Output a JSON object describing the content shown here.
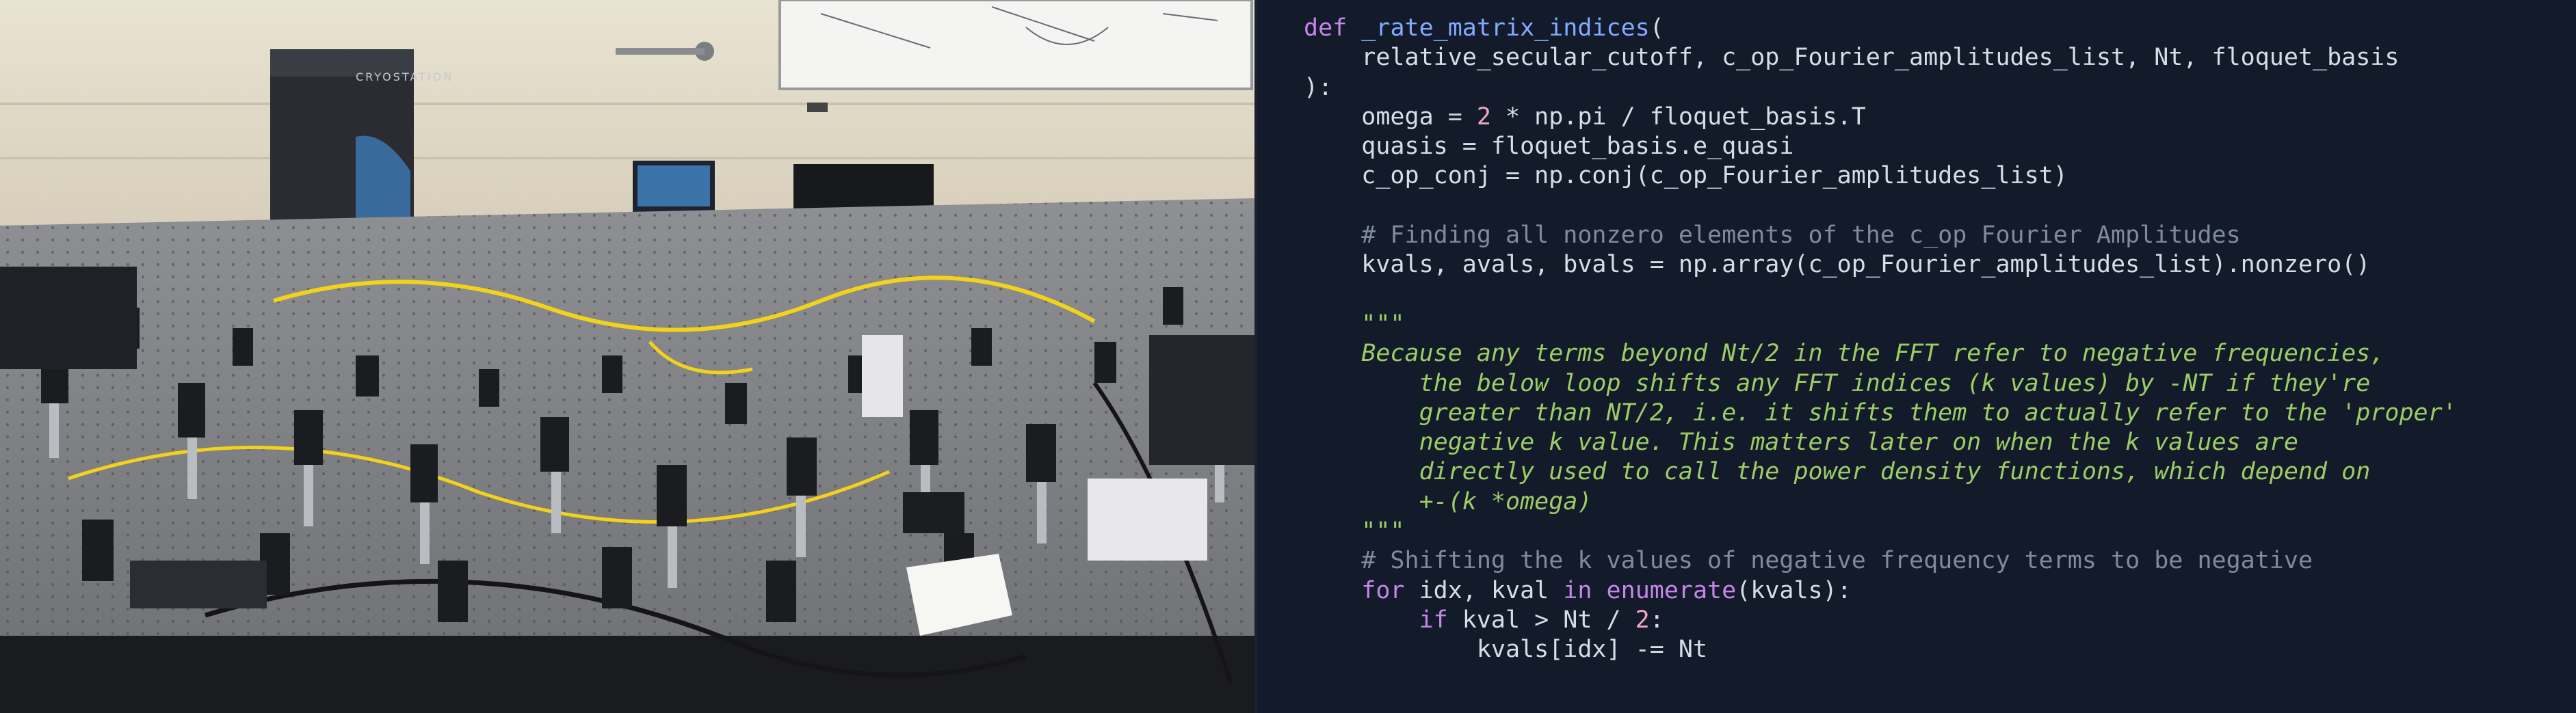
{
  "photo": {
    "description_icon": "lab-photo",
    "cryostation_label": "CRYOSTATION"
  },
  "code": {
    "lines": [
      [
        {
          "t": "kw",
          "v": "def "
        },
        {
          "t": "fn",
          "v": "_rate_matrix_indices"
        },
        {
          "t": "plain",
          "v": "("
        }
      ],
      [
        {
          "t": "plain",
          "v": "    relative_secular_cutoff, c_op_Fourier_amplitudes_list, Nt, floquet_basis"
        }
      ],
      [
        {
          "t": "plain",
          "v": "):"
        }
      ],
      [
        {
          "t": "plain",
          "v": "    omega "
        },
        {
          "t": "op",
          "v": "= "
        },
        {
          "t": "num",
          "v": "2"
        },
        {
          "t": "plain",
          "v": " * np.pi / floquet_basis.T"
        }
      ],
      [
        {
          "t": "plain",
          "v": "    quasis = floquet_basis.e_quasi"
        }
      ],
      [
        {
          "t": "plain",
          "v": "    c_op_conj = np.conj(c_op_Fourier_amplitudes_list)"
        }
      ],
      [
        {
          "t": "plain",
          "v": ""
        }
      ],
      [
        {
          "t": "comment",
          "v": "    # Finding all nonzero elements of the c_op Fourier Amplitudes"
        }
      ],
      [
        {
          "t": "plain",
          "v": "    kvals, avals, bvals = np.array(c_op_Fourier_amplitudes_list).nonzero()"
        }
      ],
      [
        {
          "t": "plain",
          "v": ""
        }
      ],
      [
        {
          "t": "doc",
          "v": "    \"\"\""
        }
      ],
      [
        {
          "t": "doc",
          "v": "    Because any terms beyond Nt/2 in the FFT refer to negative frequencies,"
        }
      ],
      [
        {
          "t": "doc",
          "v": "        the below loop shifts any FFT indices (k values) by -NT if they're"
        }
      ],
      [
        {
          "t": "doc",
          "v": "        greater than NT/2, i.e. it shifts them to actually refer to the 'proper'"
        }
      ],
      [
        {
          "t": "doc",
          "v": "        negative k value. This matters later on when the k values are"
        }
      ],
      [
        {
          "t": "doc",
          "v": "        directly used to call the power density functions, which depend on"
        }
      ],
      [
        {
          "t": "doc",
          "v": "        +-(k *omega)"
        }
      ],
      [
        {
          "t": "doc",
          "v": "    \"\"\""
        }
      ],
      [
        {
          "t": "comment",
          "v": "    # Shifting the k values of negative frequency terms to be negative"
        }
      ],
      [
        {
          "t": "kw",
          "v": "    for"
        },
        {
          "t": "plain",
          "v": " idx, kval "
        },
        {
          "t": "kw",
          "v": "in"
        },
        {
          "t": "plain",
          "v": " "
        },
        {
          "t": "builtin",
          "v": "enumerate"
        },
        {
          "t": "plain",
          "v": "(kvals):"
        }
      ],
      [
        {
          "t": "kw",
          "v": "        if"
        },
        {
          "t": "plain",
          "v": " kval > Nt / "
        },
        {
          "t": "num",
          "v": "2"
        },
        {
          "t": "plain",
          "v": ":"
        }
      ],
      [
        {
          "t": "plain",
          "v": "            kvals[idx] -= Nt"
        }
      ]
    ]
  },
  "colors": {
    "code_background": "#131a2a",
    "keyword": "#c586e8",
    "function_name": "#82aaff",
    "number": "#f2a5c3",
    "comment": "#7f8a9e",
    "docstring": "#9ccc65"
  }
}
